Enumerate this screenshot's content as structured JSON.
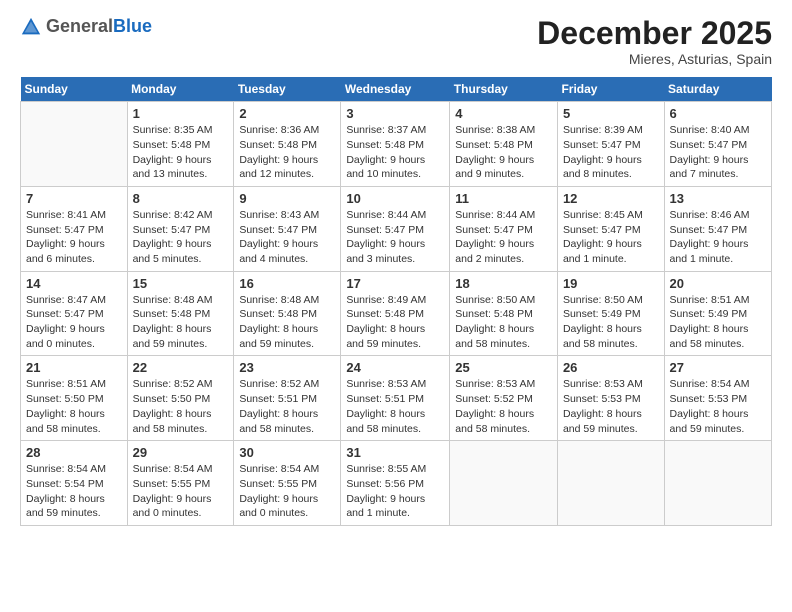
{
  "header": {
    "logo_general": "General",
    "logo_blue": "Blue",
    "month_year": "December 2025",
    "location": "Mieres, Asturias, Spain"
  },
  "days_of_week": [
    "Sunday",
    "Monday",
    "Tuesday",
    "Wednesday",
    "Thursday",
    "Friday",
    "Saturday"
  ],
  "weeks": [
    [
      {
        "num": "",
        "sunrise": "",
        "sunset": "",
        "daylight": ""
      },
      {
        "num": "1",
        "sunrise": "Sunrise: 8:35 AM",
        "sunset": "Sunset: 5:48 PM",
        "daylight": "Daylight: 9 hours and 13 minutes."
      },
      {
        "num": "2",
        "sunrise": "Sunrise: 8:36 AM",
        "sunset": "Sunset: 5:48 PM",
        "daylight": "Daylight: 9 hours and 12 minutes."
      },
      {
        "num": "3",
        "sunrise": "Sunrise: 8:37 AM",
        "sunset": "Sunset: 5:48 PM",
        "daylight": "Daylight: 9 hours and 10 minutes."
      },
      {
        "num": "4",
        "sunrise": "Sunrise: 8:38 AM",
        "sunset": "Sunset: 5:48 PM",
        "daylight": "Daylight: 9 hours and 9 minutes."
      },
      {
        "num": "5",
        "sunrise": "Sunrise: 8:39 AM",
        "sunset": "Sunset: 5:47 PM",
        "daylight": "Daylight: 9 hours and 8 minutes."
      },
      {
        "num": "6",
        "sunrise": "Sunrise: 8:40 AM",
        "sunset": "Sunset: 5:47 PM",
        "daylight": "Daylight: 9 hours and 7 minutes."
      }
    ],
    [
      {
        "num": "7",
        "sunrise": "Sunrise: 8:41 AM",
        "sunset": "Sunset: 5:47 PM",
        "daylight": "Daylight: 9 hours and 6 minutes."
      },
      {
        "num": "8",
        "sunrise": "Sunrise: 8:42 AM",
        "sunset": "Sunset: 5:47 PM",
        "daylight": "Daylight: 9 hours and 5 minutes."
      },
      {
        "num": "9",
        "sunrise": "Sunrise: 8:43 AM",
        "sunset": "Sunset: 5:47 PM",
        "daylight": "Daylight: 9 hours and 4 minutes."
      },
      {
        "num": "10",
        "sunrise": "Sunrise: 8:44 AM",
        "sunset": "Sunset: 5:47 PM",
        "daylight": "Daylight: 9 hours and 3 minutes."
      },
      {
        "num": "11",
        "sunrise": "Sunrise: 8:44 AM",
        "sunset": "Sunset: 5:47 PM",
        "daylight": "Daylight: 9 hours and 2 minutes."
      },
      {
        "num": "12",
        "sunrise": "Sunrise: 8:45 AM",
        "sunset": "Sunset: 5:47 PM",
        "daylight": "Daylight: 9 hours and 1 minute."
      },
      {
        "num": "13",
        "sunrise": "Sunrise: 8:46 AM",
        "sunset": "Sunset: 5:47 PM",
        "daylight": "Daylight: 9 hours and 1 minute."
      }
    ],
    [
      {
        "num": "14",
        "sunrise": "Sunrise: 8:47 AM",
        "sunset": "Sunset: 5:47 PM",
        "daylight": "Daylight: 9 hours and 0 minutes."
      },
      {
        "num": "15",
        "sunrise": "Sunrise: 8:48 AM",
        "sunset": "Sunset: 5:48 PM",
        "daylight": "Daylight: 8 hours and 59 minutes."
      },
      {
        "num": "16",
        "sunrise": "Sunrise: 8:48 AM",
        "sunset": "Sunset: 5:48 PM",
        "daylight": "Daylight: 8 hours and 59 minutes."
      },
      {
        "num": "17",
        "sunrise": "Sunrise: 8:49 AM",
        "sunset": "Sunset: 5:48 PM",
        "daylight": "Daylight: 8 hours and 59 minutes."
      },
      {
        "num": "18",
        "sunrise": "Sunrise: 8:50 AM",
        "sunset": "Sunset: 5:48 PM",
        "daylight": "Daylight: 8 hours and 58 minutes."
      },
      {
        "num": "19",
        "sunrise": "Sunrise: 8:50 AM",
        "sunset": "Sunset: 5:49 PM",
        "daylight": "Daylight: 8 hours and 58 minutes."
      },
      {
        "num": "20",
        "sunrise": "Sunrise: 8:51 AM",
        "sunset": "Sunset: 5:49 PM",
        "daylight": "Daylight: 8 hours and 58 minutes."
      }
    ],
    [
      {
        "num": "21",
        "sunrise": "Sunrise: 8:51 AM",
        "sunset": "Sunset: 5:50 PM",
        "daylight": "Daylight: 8 hours and 58 minutes."
      },
      {
        "num": "22",
        "sunrise": "Sunrise: 8:52 AM",
        "sunset": "Sunset: 5:50 PM",
        "daylight": "Daylight: 8 hours and 58 minutes."
      },
      {
        "num": "23",
        "sunrise": "Sunrise: 8:52 AM",
        "sunset": "Sunset: 5:51 PM",
        "daylight": "Daylight: 8 hours and 58 minutes."
      },
      {
        "num": "24",
        "sunrise": "Sunrise: 8:53 AM",
        "sunset": "Sunset: 5:51 PM",
        "daylight": "Daylight: 8 hours and 58 minutes."
      },
      {
        "num": "25",
        "sunrise": "Sunrise: 8:53 AM",
        "sunset": "Sunset: 5:52 PM",
        "daylight": "Daylight: 8 hours and 58 minutes."
      },
      {
        "num": "26",
        "sunrise": "Sunrise: 8:53 AM",
        "sunset": "Sunset: 5:53 PM",
        "daylight": "Daylight: 8 hours and 59 minutes."
      },
      {
        "num": "27",
        "sunrise": "Sunrise: 8:54 AM",
        "sunset": "Sunset: 5:53 PM",
        "daylight": "Daylight: 8 hours and 59 minutes."
      }
    ],
    [
      {
        "num": "28",
        "sunrise": "Sunrise: 8:54 AM",
        "sunset": "Sunset: 5:54 PM",
        "daylight": "Daylight: 8 hours and 59 minutes."
      },
      {
        "num": "29",
        "sunrise": "Sunrise: 8:54 AM",
        "sunset": "Sunset: 5:55 PM",
        "daylight": "Daylight: 9 hours and 0 minutes."
      },
      {
        "num": "30",
        "sunrise": "Sunrise: 8:54 AM",
        "sunset": "Sunset: 5:55 PM",
        "daylight": "Daylight: 9 hours and 0 minutes."
      },
      {
        "num": "31",
        "sunrise": "Sunrise: 8:55 AM",
        "sunset": "Sunset: 5:56 PM",
        "daylight": "Daylight: 9 hours and 1 minute."
      },
      {
        "num": "",
        "sunrise": "",
        "sunset": "",
        "daylight": ""
      },
      {
        "num": "",
        "sunrise": "",
        "sunset": "",
        "daylight": ""
      },
      {
        "num": "",
        "sunrise": "",
        "sunset": "",
        "daylight": ""
      }
    ]
  ]
}
